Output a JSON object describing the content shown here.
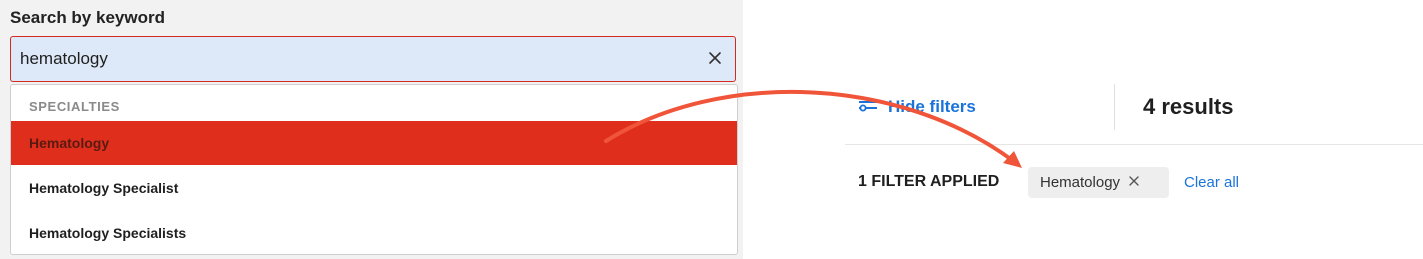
{
  "search": {
    "label": "Search by keyword",
    "value": "hematology"
  },
  "dropdown": {
    "header": "SPECIALTIES",
    "items": [
      {
        "label": "Hematology",
        "selected": true
      },
      {
        "label": "Hematology Specialist",
        "selected": false
      },
      {
        "label": "Hematology Specialists",
        "selected": false
      }
    ]
  },
  "results": {
    "hide_filters_label": "Hide filters",
    "count_label": "4 results"
  },
  "filters": {
    "applied_label": "1 FILTER APPLIED",
    "chips": [
      {
        "label": "Hematology"
      }
    ],
    "clear_all_label": "Clear all"
  },
  "colors": {
    "accent_red": "#df2f1c",
    "link_blue": "#1a73d9",
    "annotation_arrow": "#f0553a"
  }
}
